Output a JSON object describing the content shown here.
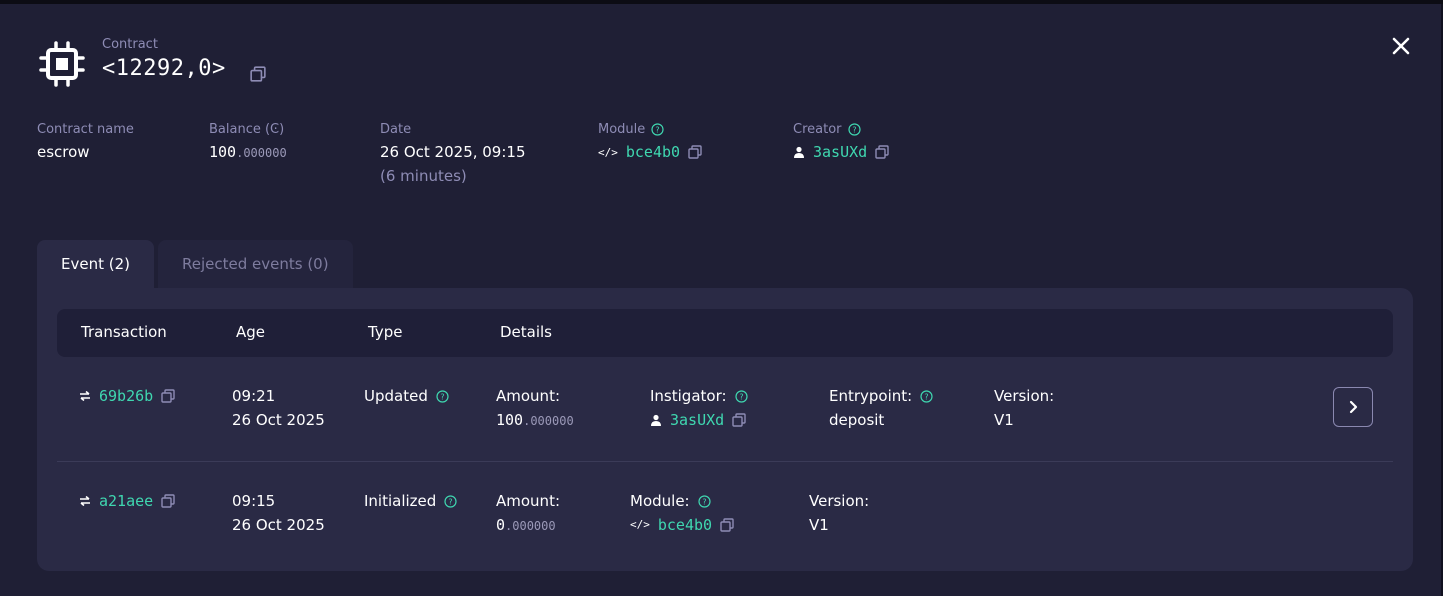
{
  "header": {
    "label": "Contract",
    "title": "<12292,0>"
  },
  "meta": {
    "contract_name": {
      "label": "Contract name",
      "value": "escrow"
    },
    "balance": {
      "label": "Balance (Ͼ)",
      "int": "100",
      "dec": ".000000"
    },
    "date": {
      "label": "Date",
      "value": "26 Oct 2025, 09:15",
      "relative": "(6 minutes)"
    },
    "module": {
      "label": "Module",
      "value": "bce4b0"
    },
    "creator": {
      "label": "Creator",
      "value": "3asUXd"
    }
  },
  "tabs": [
    {
      "label": "Event (2)"
    },
    {
      "label": "Rejected events (0)"
    }
  ],
  "table": {
    "headers": [
      "Transaction",
      "Age",
      "Type",
      "Details"
    ],
    "rows": [
      {
        "tx": "69b26b",
        "time": "09:21",
        "date": "26 Oct 2025",
        "type": "Updated",
        "amount_label": "Amount:",
        "amount_int": "100",
        "amount_dec": ".000000",
        "instigator_label": "Instigator:",
        "instigator": "3asUXd",
        "entrypoint_label": "Entrypoint:",
        "entrypoint": "deposit",
        "version_label": "Version:",
        "version": "V1"
      },
      {
        "tx": "a21aee",
        "time": "09:15",
        "date": "26 Oct 2025",
        "type": "Initialized",
        "amount_label": "Amount:",
        "amount_int": "0",
        "amount_dec": ".000000",
        "module_label": "Module:",
        "module": "bce4b0",
        "version_label": "Version:",
        "version": "V1"
      }
    ]
  },
  "colors": {
    "background": "#1f1f35",
    "accent": "#3fd7b0",
    "muted": "#8e8cb5",
    "panel": "#2a2a45"
  },
  "icons": [
    "chip-icon",
    "copy-icon",
    "close-icon",
    "help-icon",
    "code-icon",
    "user-icon",
    "transfer-icon",
    "chevron-right-icon"
  ]
}
